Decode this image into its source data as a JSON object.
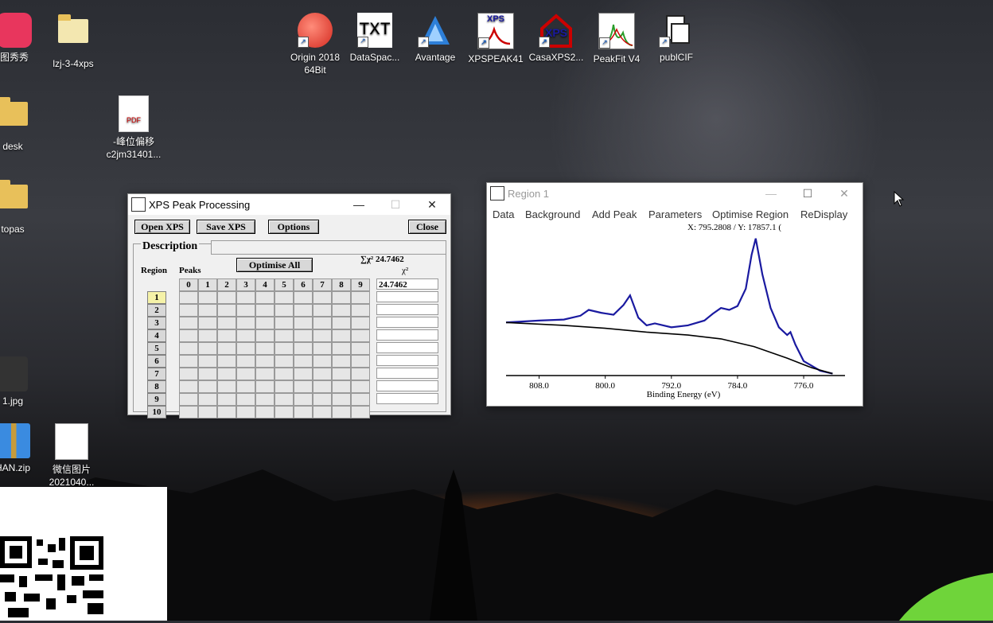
{
  "desktop": {
    "icons": [
      {
        "label": "图秀秀",
        "icon": "meitu-icon"
      },
      {
        "label": "lzj-3-4xps",
        "icon": "folder-icon"
      },
      {
        "label": "desk",
        "icon": "folder-icon"
      },
      {
        "label": "-峰位偏移\nc2jm31401...",
        "icon": "pdf-icon"
      },
      {
        "label": "topas",
        "icon": "folder-icon"
      },
      {
        "label": "1.jpg",
        "icon": "image-icon"
      },
      {
        "label": "HAN.zip",
        "icon": "zip-icon"
      },
      {
        "label": "微信图片\n2021040...",
        "icon": "qr-image-icon"
      },
      {
        "label": "Origin 2018\n64Bit",
        "icon": "origin-icon"
      },
      {
        "label": "DataSpac...",
        "icon": "txt-icon",
        "glyph": "TXT"
      },
      {
        "label": "Avantage",
        "icon": "avantage-icon"
      },
      {
        "label": "XPSPEAK41",
        "icon": "xpspeak-icon",
        "glyph": "XPS"
      },
      {
        "label": "CasaXPS2...",
        "icon": "casaxps-icon",
        "glyph": "XPS"
      },
      {
        "label": "PeakFit V4",
        "icon": "peakfit-icon"
      },
      {
        "label": "publCIF",
        "icon": "publcif-icon"
      }
    ]
  },
  "xps_window": {
    "title": "XPS Peak Processing",
    "buttons": {
      "open": "Open XPS",
      "save": "Save XPS",
      "options": "Options",
      "close": "Close",
      "optimise_all": "Optimise All"
    },
    "description_label": "Description",
    "region_label": "Region",
    "peaks_label": "Peaks",
    "chi_sum_label": "∑χ² 24.7462",
    "chi_label": "χ²",
    "peak_columns": [
      "0",
      "1",
      "2",
      "3",
      "4",
      "5",
      "6",
      "7",
      "8",
      "9"
    ],
    "regions": [
      "1",
      "2",
      "3",
      "4",
      "5",
      "6",
      "7",
      "8",
      "9",
      "10"
    ],
    "chi_values": [
      "24.7462",
      "",
      "",
      "",
      "",
      "",
      "",
      "",
      "",
      ""
    ]
  },
  "region_window": {
    "title": "Region 1",
    "menu": [
      "Data",
      "Background",
      "Add Peak",
      "Parameters",
      "Optimise Region",
      "ReDisplay"
    ],
    "coords": "X: 795.2808 / Y: 17857.1 (",
    "xlabel": "Binding Energy (eV)"
  },
  "chart_data": {
    "type": "line",
    "xlabel": "Binding Energy (eV)",
    "x_ticks": [
      "808.0",
      "800.0",
      "792.0",
      "784.0",
      "776.0"
    ],
    "xlim": [
      812.0,
      771.0
    ],
    "x_reversed": true,
    "series": [
      {
        "color": "#1a1aa0",
        "x": [
          812,
          808,
          805,
          803,
          802,
          800.5,
          799,
          797.8,
          797,
          796,
          795,
          794,
          792,
          790,
          788,
          787,
          786,
          785,
          784,
          783,
          782.3,
          781.8,
          781,
          780,
          779,
          778,
          777.6,
          777,
          776,
          774,
          772.5
        ],
        "y": [
          0.55,
          0.57,
          0.58,
          0.62,
          0.68,
          0.65,
          0.63,
          0.73,
          0.83,
          0.6,
          0.52,
          0.54,
          0.5,
          0.52,
          0.57,
          0.64,
          0.7,
          0.68,
          0.72,
          0.9,
          1.25,
          1.42,
          1.05,
          0.7,
          0.5,
          0.42,
          0.45,
          0.32,
          0.15,
          0.05,
          0.02
        ]
      },
      {
        "color": "#000000",
        "x": [
          812,
          805,
          800,
          795,
          790,
          786,
          782,
          778,
          775,
          772.5
        ],
        "y": [
          0.55,
          0.52,
          0.49,
          0.45,
          0.42,
          0.38,
          0.3,
          0.18,
          0.08,
          0.02
        ]
      }
    ]
  },
  "colors": {
    "accent_blue": "#1a1aa0",
    "window_bg": "#f0f0f0",
    "selected_row": "#f5f2a8"
  }
}
